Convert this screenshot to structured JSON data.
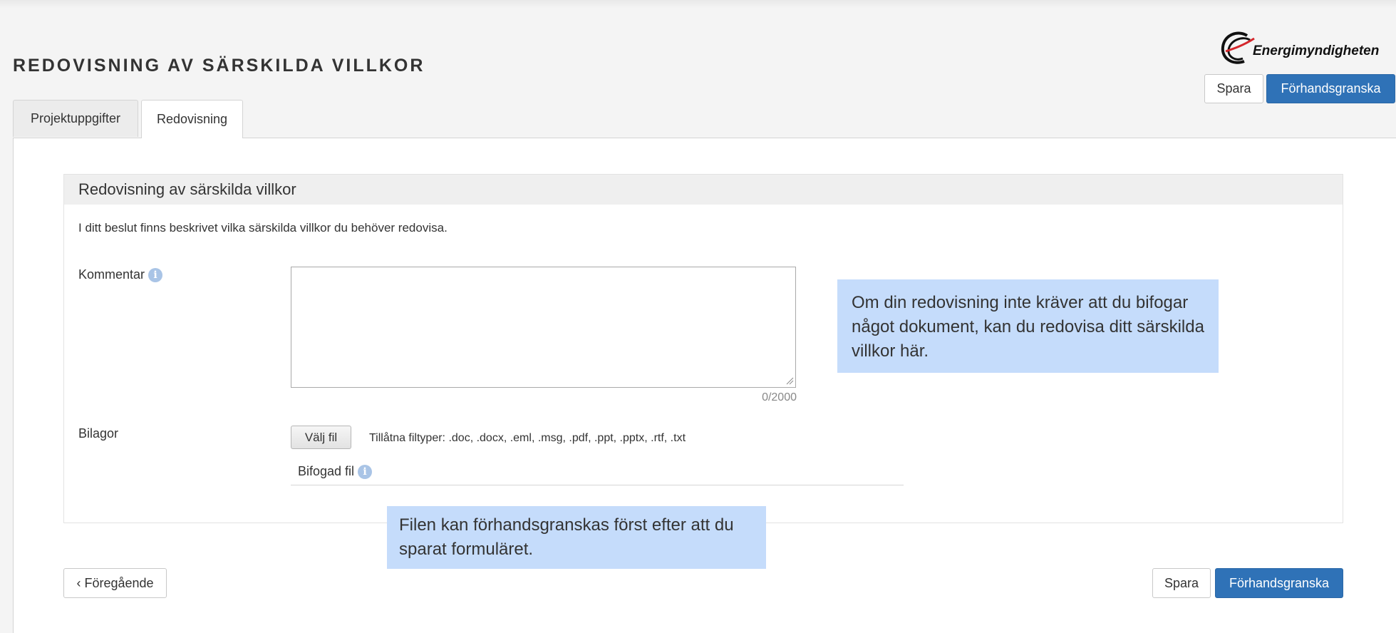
{
  "header": {
    "title": "REDOVISNING AV SÄRSKILDA VILLKOR",
    "logo_text": "Energimyndigheten",
    "save_label": "Spara",
    "preview_label": "Förhandsgranska"
  },
  "tabs": [
    {
      "label": "Projektuppgifter",
      "active": false
    },
    {
      "label": "Redovisning",
      "active": true
    }
  ],
  "section": {
    "title": "Redovisning av särskilda villkor",
    "intro": "I ditt beslut finns beskrivet vilka särskilda villkor du behöver redovisa.",
    "comment_label": "Kommentar",
    "comment_value": "",
    "char_counter": "0/2000",
    "attachments_label": "Bilagor",
    "choose_file_label": "Välj fil",
    "allowed_filetypes": "Tillåtna filtyper: .doc, .docx, .eml, .msg, .pdf, .ppt, .pptx, .rtf, .txt",
    "attached_file_label": "Bifogad fil"
  },
  "callouts": {
    "comment_hint": "Om din redovisning inte kräver att du bifogar något dokument, kan du redovisa ditt särskilda villkor här.",
    "file_hint": "Filen kan förhandsgranskas först efter att du sparat formuläret."
  },
  "footer": {
    "previous_label": "‹ Föregående",
    "save_label": "Spara",
    "preview_label": "Förhandsgranska"
  },
  "colors": {
    "primary": "#2f72b7",
    "callout": "#c5dcfb",
    "info_icon": "#a9c4e6"
  }
}
